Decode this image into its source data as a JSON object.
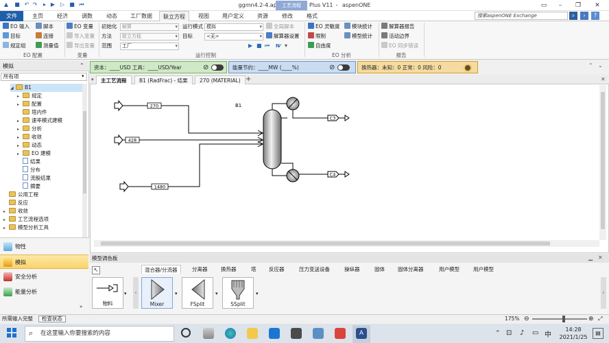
{
  "title": {
    "doc": "ggmn4.2-4.apw",
    "app": "Aspen Plus V11",
    "suite": "aspenONE",
    "context_tab": "工艺流程"
  },
  "menu": {
    "tabs": [
      "文件",
      "主页",
      "经济",
      "调数",
      "动态",
      "工厂数据",
      "联立方程",
      "视图",
      "用户定义",
      "资源",
      "修改",
      "格式"
    ],
    "search_placeholder": "搜索aspenONE Exchange"
  },
  "ribbon": {
    "eo_config": {
      "items": [
        "EO 输入",
        "目标",
        "规定组"
      ],
      "sub": [
        "脚本",
        "连接",
        "测量值"
      ],
      "group": "EO 配置"
    },
    "variables": {
      "items": [
        "EO 变量",
        "导入变量",
        "导出变量"
      ],
      "group": "变量"
    },
    "run_fields": {
      "init_label": "初始化",
      "init_value": "解算",
      "method_label": "方法",
      "method_value": "联立方程",
      "scope_label": "范围",
      "scope_value": "工厂"
    },
    "run_control": {
      "mode_label": "运行模式",
      "mode_value": "模拟",
      "target_label": "目标",
      "target_value": "<无>",
      "script_all": "全局脚本",
      "solver_settings": "解算器设置",
      "group": "运行控制"
    },
    "eo_analysis": {
      "items": [
        "EO 灵敏度",
        "限制",
        "自由度"
      ],
      "sub": [
        "模块统计",
        "模型统计"
      ],
      "group": "EO 分析"
    },
    "report": {
      "items": [
        "解算器报告",
        "活动边界",
        "EO 同步错误"
      ],
      "group": "报告"
    }
  },
  "energy_bar": {
    "p1": "资本：____USD  工具：____USD/Year",
    "p2": "能量节约：____MW  (____%)",
    "p3": "换热器：未知：0  正常：0  风险：0"
  },
  "nav": {
    "header": "模拟",
    "filter": "所有项",
    "tree": [
      "B1",
      "规定",
      "配置",
      "塔内件",
      "速率模式建模",
      "分析",
      "收敛",
      "动态",
      "EO 建模",
      "结果",
      "分布",
      "流股结果",
      "摘要",
      "公用工程",
      "反应",
      "收敛",
      "工艺流程选项",
      "模型分析工具"
    ],
    "bottom": [
      "物性",
      "模拟",
      "安全分析",
      "能量分析"
    ]
  },
  "doc_tabs": [
    "主工艺流程",
    "B1 (RadFrac) - 结果",
    "270 (MATERIAL)"
  ],
  "flowsheet": {
    "block": "B1",
    "feeds": [
      "270",
      "428",
      "1480"
    ],
    "products": [
      "C3",
      "C4"
    ]
  },
  "palette": {
    "header": "模型调色板",
    "tabs": [
      "混合器/分流器",
      "分离器",
      "换热器",
      "塔",
      "反应器",
      "压力变送设备",
      "操纵器",
      "固体",
      "固体分离器",
      "用户模型",
      "用户模型"
    ],
    "blocks": [
      "物料",
      "Mixer",
      "FSplit",
      "SSplit"
    ]
  },
  "status": {
    "left": "所需输入完整",
    "check": "检查状态",
    "zoom": "175%"
  },
  "taskbar": {
    "search": "在这里输入你要搜索的内容",
    "time": "14:28",
    "date": "2021/1/25",
    "ime": "中"
  }
}
